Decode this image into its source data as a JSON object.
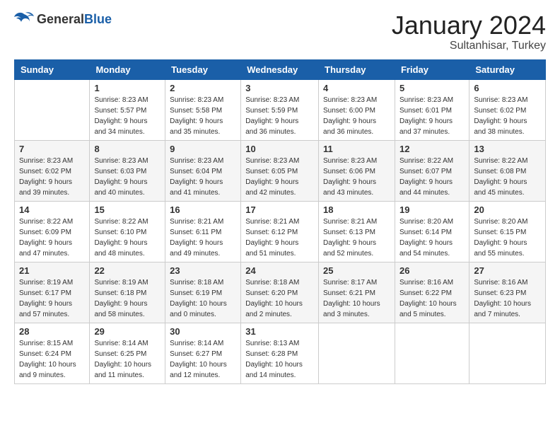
{
  "header": {
    "logo_general": "General",
    "logo_blue": "Blue",
    "month": "January 2024",
    "location": "Sultanhisar, Turkey"
  },
  "weekdays": [
    "Sunday",
    "Monday",
    "Tuesday",
    "Wednesday",
    "Thursday",
    "Friday",
    "Saturday"
  ],
  "weeks": [
    [
      {
        "day": "",
        "info": ""
      },
      {
        "day": "1",
        "info": "Sunrise: 8:23 AM\nSunset: 5:57 PM\nDaylight: 9 hours\nand 34 minutes."
      },
      {
        "day": "2",
        "info": "Sunrise: 8:23 AM\nSunset: 5:58 PM\nDaylight: 9 hours\nand 35 minutes."
      },
      {
        "day": "3",
        "info": "Sunrise: 8:23 AM\nSunset: 5:59 PM\nDaylight: 9 hours\nand 36 minutes."
      },
      {
        "day": "4",
        "info": "Sunrise: 8:23 AM\nSunset: 6:00 PM\nDaylight: 9 hours\nand 36 minutes."
      },
      {
        "day": "5",
        "info": "Sunrise: 8:23 AM\nSunset: 6:01 PM\nDaylight: 9 hours\nand 37 minutes."
      },
      {
        "day": "6",
        "info": "Sunrise: 8:23 AM\nSunset: 6:02 PM\nDaylight: 9 hours\nand 38 minutes."
      }
    ],
    [
      {
        "day": "7",
        "info": "Sunrise: 8:23 AM\nSunset: 6:02 PM\nDaylight: 9 hours\nand 39 minutes."
      },
      {
        "day": "8",
        "info": "Sunrise: 8:23 AM\nSunset: 6:03 PM\nDaylight: 9 hours\nand 40 minutes."
      },
      {
        "day": "9",
        "info": "Sunrise: 8:23 AM\nSunset: 6:04 PM\nDaylight: 9 hours\nand 41 minutes."
      },
      {
        "day": "10",
        "info": "Sunrise: 8:23 AM\nSunset: 6:05 PM\nDaylight: 9 hours\nand 42 minutes."
      },
      {
        "day": "11",
        "info": "Sunrise: 8:23 AM\nSunset: 6:06 PM\nDaylight: 9 hours\nand 43 minutes."
      },
      {
        "day": "12",
        "info": "Sunrise: 8:22 AM\nSunset: 6:07 PM\nDaylight: 9 hours\nand 44 minutes."
      },
      {
        "day": "13",
        "info": "Sunrise: 8:22 AM\nSunset: 6:08 PM\nDaylight: 9 hours\nand 45 minutes."
      }
    ],
    [
      {
        "day": "14",
        "info": "Sunrise: 8:22 AM\nSunset: 6:09 PM\nDaylight: 9 hours\nand 47 minutes."
      },
      {
        "day": "15",
        "info": "Sunrise: 8:22 AM\nSunset: 6:10 PM\nDaylight: 9 hours\nand 48 minutes."
      },
      {
        "day": "16",
        "info": "Sunrise: 8:21 AM\nSunset: 6:11 PM\nDaylight: 9 hours\nand 49 minutes."
      },
      {
        "day": "17",
        "info": "Sunrise: 8:21 AM\nSunset: 6:12 PM\nDaylight: 9 hours\nand 51 minutes."
      },
      {
        "day": "18",
        "info": "Sunrise: 8:21 AM\nSunset: 6:13 PM\nDaylight: 9 hours\nand 52 minutes."
      },
      {
        "day": "19",
        "info": "Sunrise: 8:20 AM\nSunset: 6:14 PM\nDaylight: 9 hours\nand 54 minutes."
      },
      {
        "day": "20",
        "info": "Sunrise: 8:20 AM\nSunset: 6:15 PM\nDaylight: 9 hours\nand 55 minutes."
      }
    ],
    [
      {
        "day": "21",
        "info": "Sunrise: 8:19 AM\nSunset: 6:17 PM\nDaylight: 9 hours\nand 57 minutes."
      },
      {
        "day": "22",
        "info": "Sunrise: 8:19 AM\nSunset: 6:18 PM\nDaylight: 9 hours\nand 58 minutes."
      },
      {
        "day": "23",
        "info": "Sunrise: 8:18 AM\nSunset: 6:19 PM\nDaylight: 10 hours\nand 0 minutes."
      },
      {
        "day": "24",
        "info": "Sunrise: 8:18 AM\nSunset: 6:20 PM\nDaylight: 10 hours\nand 2 minutes."
      },
      {
        "day": "25",
        "info": "Sunrise: 8:17 AM\nSunset: 6:21 PM\nDaylight: 10 hours\nand 3 minutes."
      },
      {
        "day": "26",
        "info": "Sunrise: 8:16 AM\nSunset: 6:22 PM\nDaylight: 10 hours\nand 5 minutes."
      },
      {
        "day": "27",
        "info": "Sunrise: 8:16 AM\nSunset: 6:23 PM\nDaylight: 10 hours\nand 7 minutes."
      }
    ],
    [
      {
        "day": "28",
        "info": "Sunrise: 8:15 AM\nSunset: 6:24 PM\nDaylight: 10 hours\nand 9 minutes."
      },
      {
        "day": "29",
        "info": "Sunrise: 8:14 AM\nSunset: 6:25 PM\nDaylight: 10 hours\nand 11 minutes."
      },
      {
        "day": "30",
        "info": "Sunrise: 8:14 AM\nSunset: 6:27 PM\nDaylight: 10 hours\nand 12 minutes."
      },
      {
        "day": "31",
        "info": "Sunrise: 8:13 AM\nSunset: 6:28 PM\nDaylight: 10 hours\nand 14 minutes."
      },
      {
        "day": "",
        "info": ""
      },
      {
        "day": "",
        "info": ""
      },
      {
        "day": "",
        "info": ""
      }
    ]
  ]
}
